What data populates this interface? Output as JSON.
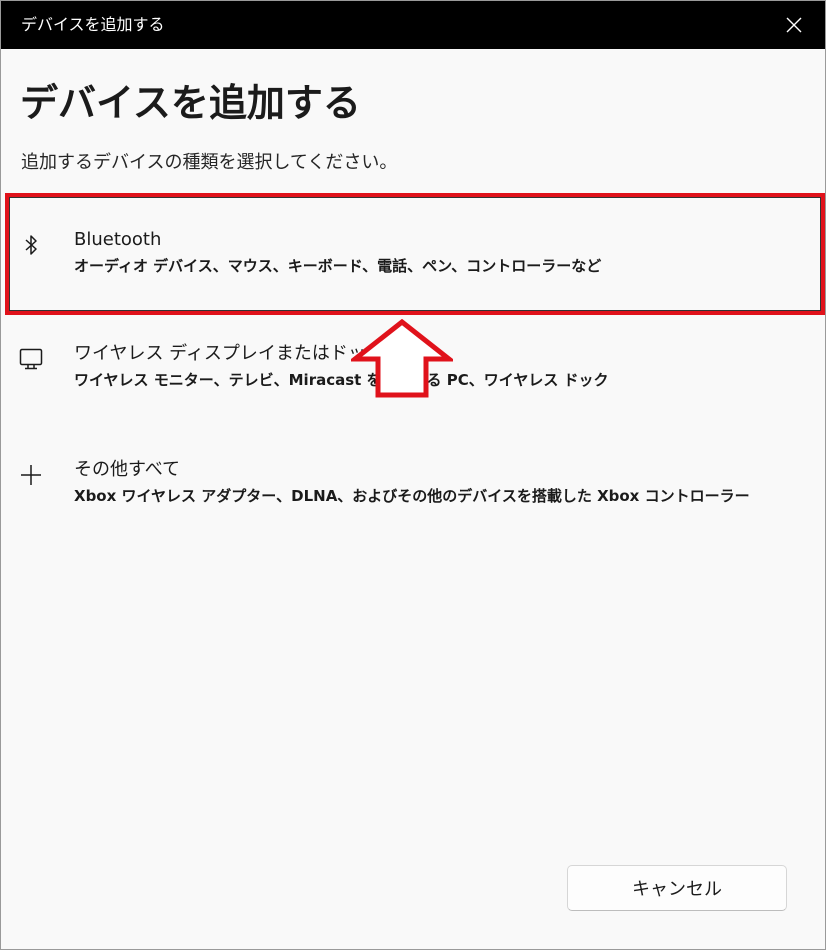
{
  "window": {
    "title": "デバイスを追加する"
  },
  "page": {
    "heading": "デバイスを追加する",
    "subtitle": "追加するデバイスの種類を選択してください。"
  },
  "options": [
    {
      "icon": "bluetooth-icon",
      "label": "Bluetooth",
      "description": "オーディオ デバイス、マウス、キーボード、電話、ペン、コントローラーなど"
    },
    {
      "icon": "monitor-icon",
      "label": "ワイヤレス ディスプレイまたはドック",
      "description": "ワイヤレス モニター、テレビ、Miracast を使用する PC、ワイヤレス ドック"
    },
    {
      "icon": "plus-icon",
      "label": "その他すべて",
      "description": "Xbox ワイヤレス アダプター、DLNA、およびその他のデバイスを搭載した Xbox コントローラー"
    }
  ],
  "footer": {
    "cancel_label": "キャンセル"
  },
  "colors": {
    "highlight": "#e0121b",
    "titlebar": "#000000"
  }
}
